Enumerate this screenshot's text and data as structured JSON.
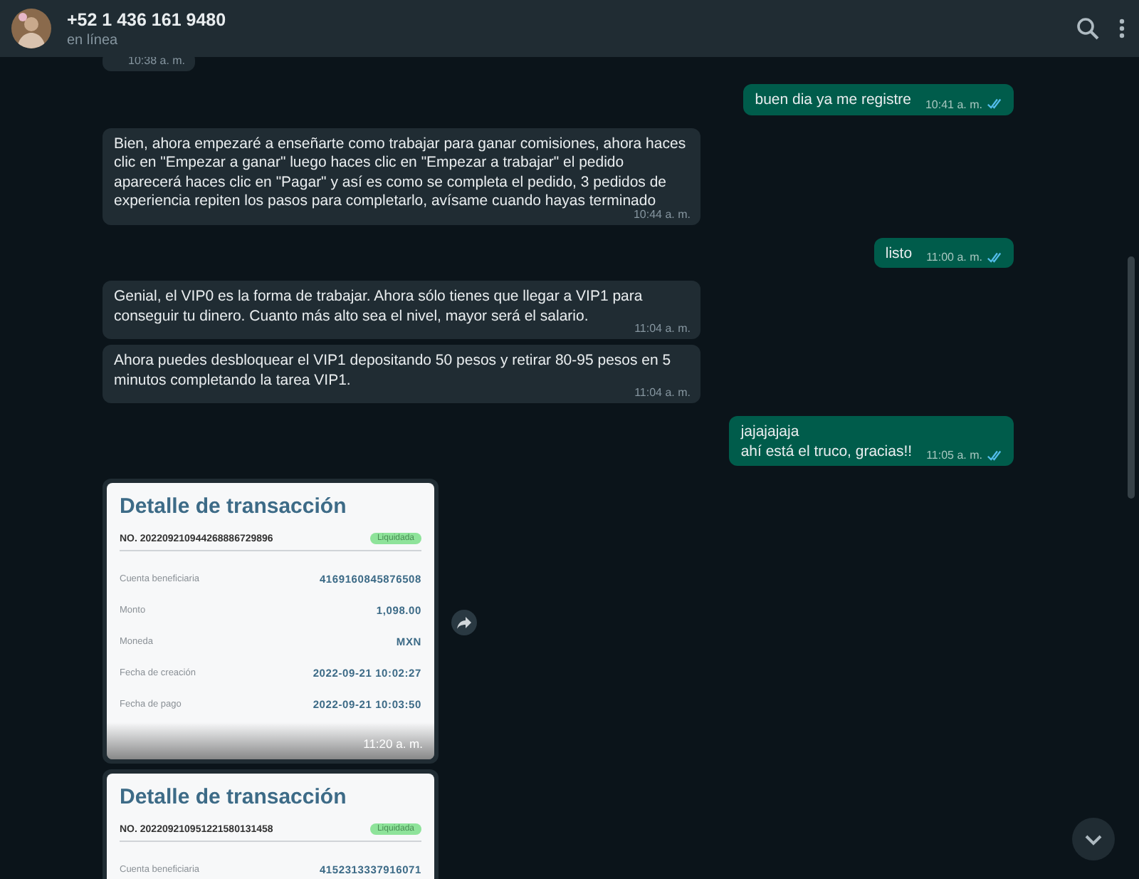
{
  "header": {
    "title": "+52 1 436 161 9480",
    "status": "en línea"
  },
  "messages": [
    {
      "kind": "text",
      "outgoing": false,
      "time": "10:38 a. m."
    },
    {
      "kind": "text",
      "outgoing": true,
      "text": "buen dia ya me registre",
      "time": "10:41 a. m.",
      "read": true
    },
    {
      "kind": "text",
      "outgoing": false,
      "text": "Bien, ahora empezaré a enseñarte como trabajar para ganar comisiones, ahora haces clic en \"Empezar a ganar\" luego haces clic en \"Empezar a trabajar\" el pedido aparecerá haces clic en \"Pagar\" y así es como se completa el pedido, 3 pedidos de experiencia repiten los pasos para completarlo, avísame cuando hayas terminado",
      "time": "10:44 a. m."
    },
    {
      "kind": "text",
      "outgoing": true,
      "text": "listo",
      "time": "11:00 a. m.",
      "read": true
    },
    {
      "kind": "text",
      "outgoing": false,
      "text": "Genial, el VIP0 es la forma de trabajar. Ahora sólo tienes que llegar a VIP1 para conseguir tu dinero. Cuanto más alto sea el nivel, mayor será el salario.",
      "time": "11:04 a. m."
    },
    {
      "kind": "text",
      "outgoing": false,
      "text": "Ahora puedes desbloquear el VIP1 depositando 50 pesos y retirar 80-95 pesos en 5 minutos completando la tarea VIP1.",
      "time": "11:04 a. m."
    },
    {
      "kind": "text",
      "outgoing": true,
      "text": "jajajajaja\nahí está el truco, gracias!!",
      "time": "11:05 a. m.",
      "read": true
    },
    {
      "kind": "receipt",
      "outgoing": false,
      "title": "Detalle de transacción",
      "number": "NO. 202209210944268886729896",
      "badge": "Liquidada",
      "rows": [
        {
          "label": "Cuenta beneficiaria",
          "value": "4169160845876508"
        },
        {
          "label": "Monto",
          "value": "1,098.00"
        },
        {
          "label": "Moneda",
          "value": "MXN"
        },
        {
          "label": "Fecha de creación",
          "value": "2022-09-21 10:02:27"
        },
        {
          "label": "Fecha de pago",
          "value": "2022-09-21 10:03:50"
        }
      ],
      "time": "11:20 a. m.",
      "forward": true
    },
    {
      "kind": "receipt",
      "outgoing": false,
      "title": "Detalle de transacción",
      "number": "NO. 202209210951221580131458",
      "badge": "Liquidada",
      "rows": [
        {
          "label": "Cuenta beneficiaria",
          "value": "4152313337916071"
        }
      ]
    }
  ]
}
